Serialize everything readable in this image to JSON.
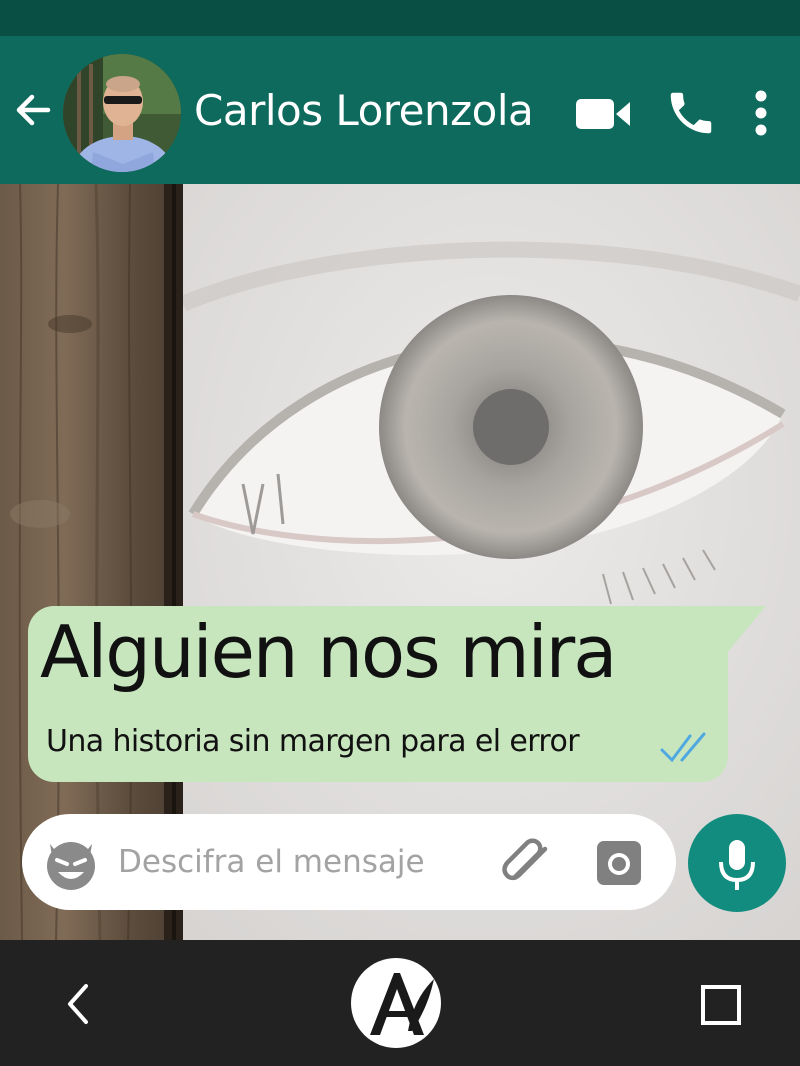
{
  "header": {
    "contact_name": "Carlos Lorenzola",
    "bg_color": "#0e6a5c",
    "icons": [
      "back-arrow-icon",
      "video-camera-icon",
      "phone-icon",
      "more-vert-icon"
    ]
  },
  "message": {
    "title": "Alguien nos mira",
    "subtitle": "Una historia sin margen para el error",
    "status": "read",
    "bubble_color": "#c8e6be",
    "tick_color": "#4fa9e0"
  },
  "composer": {
    "placeholder": "Descifra el mensaje",
    "icons": [
      "devil-emoji-icon",
      "paperclip-icon",
      "camera-icon",
      "microphone-icon"
    ],
    "mic_button_color": "#128c7e"
  },
  "nav": {
    "icons": [
      "nav-back-icon",
      "publisher-logo",
      "recents-icon"
    ]
  }
}
